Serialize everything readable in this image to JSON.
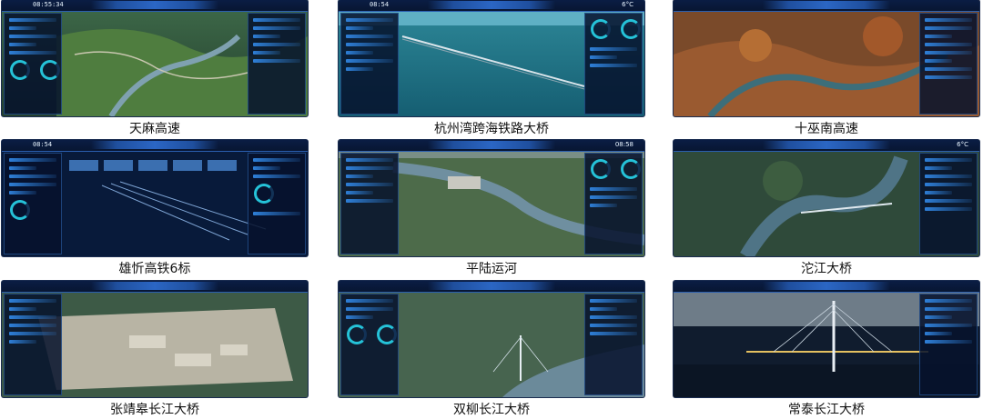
{
  "figure": {
    "items": [
      {
        "caption": "天麻高速",
        "clock": "08:55:34",
        "temperature": ""
      },
      {
        "caption": "杭州湾跨海铁路大桥",
        "clock": "08:54",
        "temperature": "6°C"
      },
      {
        "caption": "十巫南高速",
        "clock": "",
        "temperature": ""
      },
      {
        "caption": "雄忻高铁6标",
        "clock": "08:54",
        "temperature": ""
      },
      {
        "caption": "平陆运河",
        "clock": "08:58",
        "temperature": ""
      },
      {
        "caption": "沱江大桥",
        "clock": "",
        "temperature": "6°C"
      },
      {
        "caption": "张靖皋长江大桥",
        "clock": "",
        "temperature": ""
      },
      {
        "caption": "双柳长江大桥",
        "clock": "",
        "temperature": ""
      },
      {
        "caption": "常泰长江大桥",
        "clock": "",
        "temperature": ""
      }
    ]
  },
  "colors": {
    "hud_blue": "#2b66c4",
    "hud_dark": "#06122a",
    "accent_cyan": "#25c2d8"
  }
}
